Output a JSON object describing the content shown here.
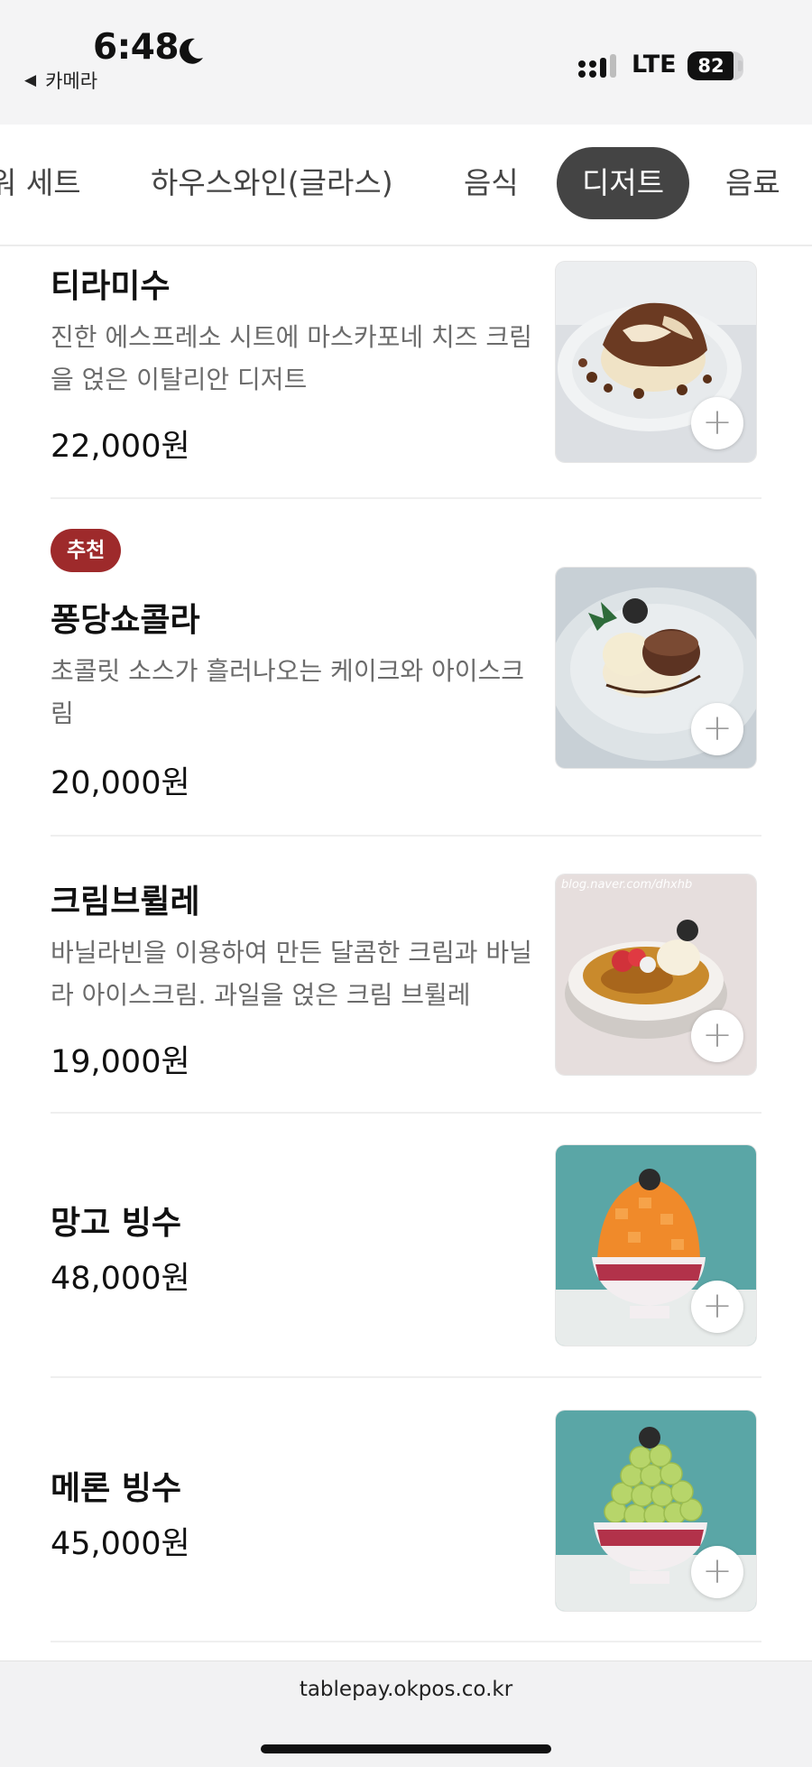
{
  "status_bar": {
    "time": "6:48",
    "back_label": "카메라",
    "network": "LTE",
    "battery_percent": "82",
    "battery_level": 0.82
  },
  "tabs": [
    {
      "label": "워 세트",
      "active": false
    },
    {
      "label": "하우스와인(글라스)",
      "active": false
    },
    {
      "label": "음식",
      "active": false
    },
    {
      "label": "디저트",
      "active": true
    },
    {
      "label": "음료",
      "active": false
    }
  ],
  "menu_items": [
    {
      "name": "티라미수",
      "description": "진한 에스프레소 시트에 마스카포네 치즈 크림을 얹은 이탈리안 디저트",
      "price": "22,000원",
      "badge": "",
      "image": "tiramisu-photo"
    },
    {
      "name": "퐁당쇼콜라",
      "description": "초콜릿 소스가 흘러나오는 케이크와 아이스크림",
      "price": "20,000원",
      "badge": "추천",
      "image": "fondant-chocolat-photo"
    },
    {
      "name": "크림브륄레",
      "description": "바닐라빈을 이용하여 만든 달콤한 크림과 바닐라 아이스크림. 과일을 얹은 크림 브륄레",
      "price": "19,000원",
      "badge": "",
      "image": "creme-brulee-photo",
      "watermark": "blog.naver.com/dhxhb"
    },
    {
      "name": "망고 빙수",
      "description": "",
      "price": "48,000원",
      "badge": "",
      "image": "mango-bingsu-photo"
    },
    {
      "name": "메론 빙수",
      "description": "",
      "price": "45,000원",
      "badge": "",
      "image": "melon-bingsu-photo"
    }
  ],
  "add_button_symbol": "+",
  "footer": {
    "url": "tablepay.okpos.co.kr"
  },
  "colors": {
    "active_tab_bg": "#444444",
    "badge_bg": "#9e2a2b",
    "status_bar_bg": "#f4f4f5"
  }
}
